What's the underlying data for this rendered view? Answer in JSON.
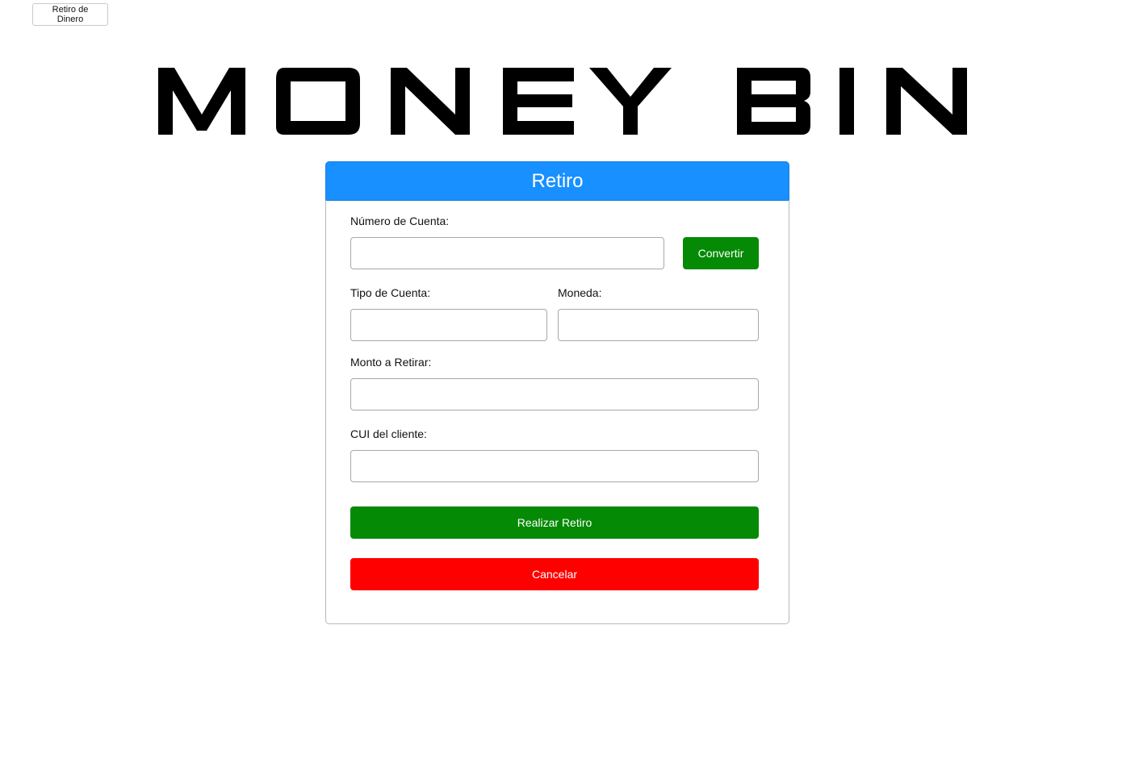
{
  "top_tab": {
    "label": "Retiro de Dinero"
  },
  "brand": {
    "logo_text": "MONEY BIN"
  },
  "form": {
    "title": "Retiro",
    "account_number": {
      "label": "Número de Cuenta:",
      "value": ""
    },
    "convert_button": "Convertir",
    "account_type": {
      "label": "Tipo de Cuenta:",
      "value": ""
    },
    "currency": {
      "label": "Moneda:",
      "value": ""
    },
    "amount": {
      "label": "Monto a Retirar:",
      "value": ""
    },
    "client_cui": {
      "label": "CUI del cliente:",
      "value": ""
    },
    "submit_button": "Realizar Retiro",
    "cancel_button": "Cancelar"
  },
  "colors": {
    "header_blue": "#1890ff",
    "primary_green": "#058a05",
    "danger_red": "#ff0000"
  }
}
